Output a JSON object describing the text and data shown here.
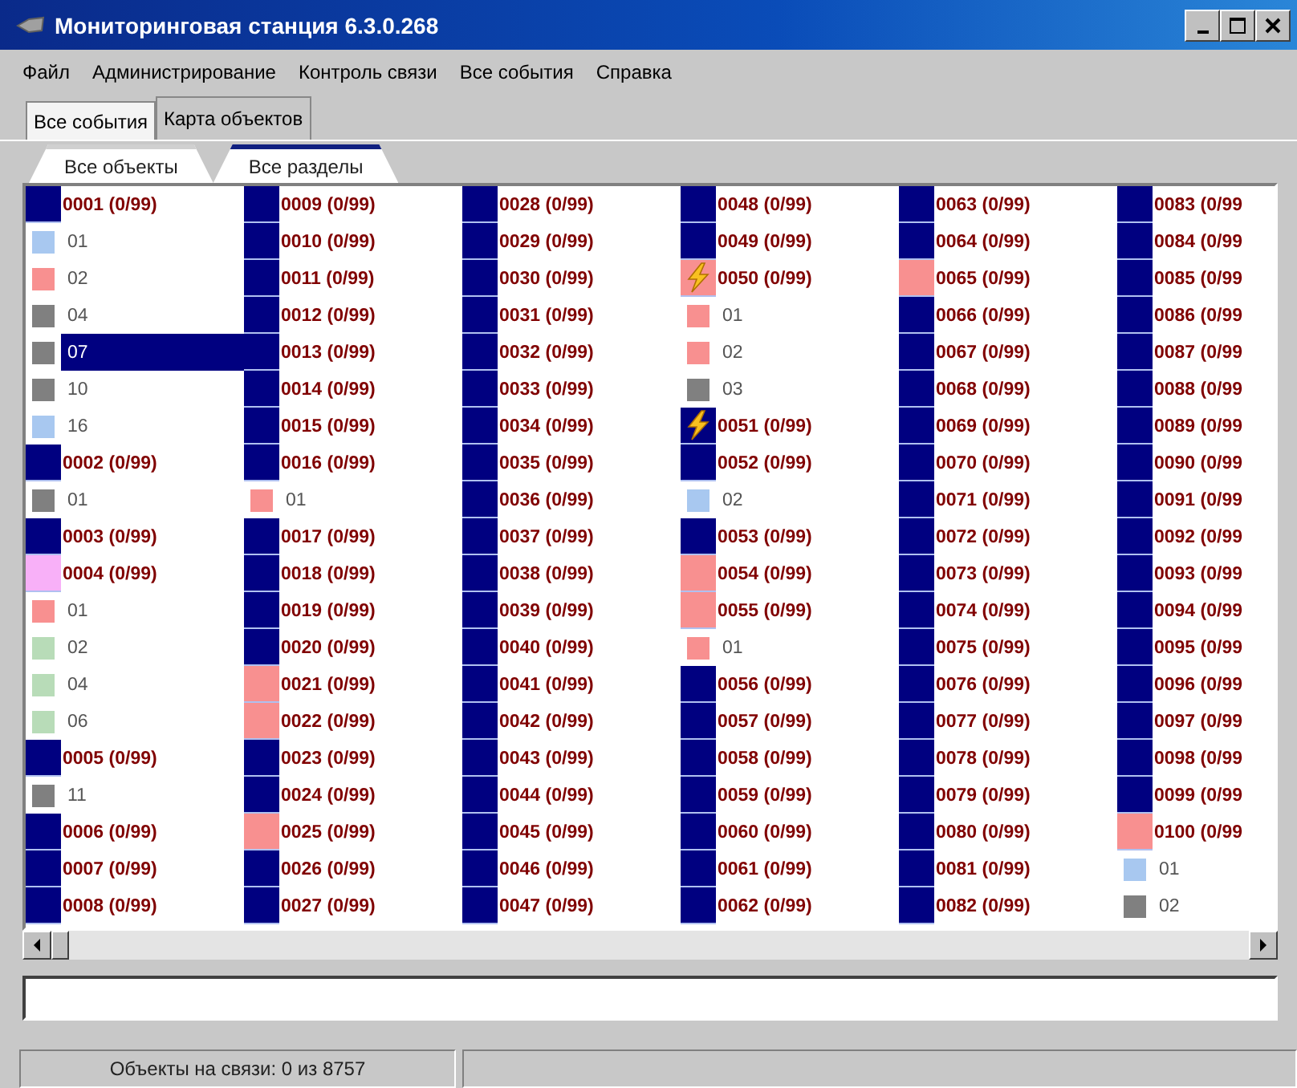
{
  "window": {
    "title": "Мониторинговая станция 6.3.0.268"
  },
  "menu": [
    "Файл",
    "Администрирование",
    "Контроль связи",
    "Все события",
    "Справка"
  ],
  "tabs": [
    {
      "label": "Все события",
      "selected": false
    },
    {
      "label": "Карта объектов",
      "selected": true
    }
  ],
  "subtabs": [
    {
      "label": "Все объекты",
      "selected": false
    },
    {
      "label": "Все разделы",
      "selected": true
    }
  ],
  "columns": [
    {
      "items": [
        {
          "kind": "object",
          "label": "0001 (0/99)",
          "color": "#000080",
          "selected": false
        },
        {
          "kind": "section",
          "label": "01",
          "color": "#a8c8f0",
          "selected": false
        },
        {
          "kind": "section",
          "label": "02",
          "color": "#f89090",
          "selected": false
        },
        {
          "kind": "section",
          "label": "04",
          "color": "#808080",
          "selected": false
        },
        {
          "kind": "section",
          "label": "07",
          "color": "#808080",
          "selected": true
        },
        {
          "kind": "section",
          "label": "10",
          "color": "#808080",
          "selected": false
        },
        {
          "kind": "section",
          "label": "16",
          "color": "#a8c8f0",
          "selected": false
        },
        {
          "kind": "object",
          "label": "0002 (0/99)",
          "color": "#000080",
          "selected": false
        },
        {
          "kind": "section",
          "label": "01",
          "color": "#808080",
          "selected": false
        },
        {
          "kind": "object",
          "label": "0003 (0/99)",
          "color": "#000080",
          "selected": false
        },
        {
          "kind": "object",
          "label": "0004 (0/99)",
          "color": "#f8b0f8",
          "selected": false
        },
        {
          "kind": "section",
          "label": "01",
          "color": "#f89090",
          "selected": false
        },
        {
          "kind": "section",
          "label": "02",
          "color": "#b8dcb8",
          "selected": false
        },
        {
          "kind": "section",
          "label": "04",
          "color": "#b8dcb8",
          "selected": false
        },
        {
          "kind": "section",
          "label": "06",
          "color": "#b8dcb8",
          "selected": false
        },
        {
          "kind": "object",
          "label": "0005 (0/99)",
          "color": "#000080",
          "selected": false
        },
        {
          "kind": "section",
          "label": "11",
          "color": "#808080",
          "selected": false
        },
        {
          "kind": "object",
          "label": "0006 (0/99)",
          "color": "#000080",
          "selected": false
        },
        {
          "kind": "object",
          "label": "0007 (0/99)",
          "color": "#000080",
          "selected": false
        },
        {
          "kind": "object",
          "label": "0008 (0/99)",
          "color": "#000080",
          "selected": false
        }
      ]
    },
    {
      "items": [
        {
          "kind": "object",
          "label": "0009 (0/99)",
          "color": "#000080",
          "selected": false
        },
        {
          "kind": "object",
          "label": "0010 (0/99)",
          "color": "#000080",
          "selected": false
        },
        {
          "kind": "object",
          "label": "0011 (0/99)",
          "color": "#000080",
          "selected": false
        },
        {
          "kind": "object",
          "label": "0012 (0/99)",
          "color": "#000080",
          "selected": false
        },
        {
          "kind": "object",
          "label": "0013 (0/99)",
          "color": "#000080",
          "selected": false
        },
        {
          "kind": "object",
          "label": "0014 (0/99)",
          "color": "#000080",
          "selected": false
        },
        {
          "kind": "object",
          "label": "0015 (0/99)",
          "color": "#000080",
          "selected": false
        },
        {
          "kind": "object",
          "label": "0016 (0/99)",
          "color": "#000080",
          "selected": false
        },
        {
          "kind": "section",
          "label": "01",
          "color": "#f89090",
          "selected": false
        },
        {
          "kind": "object",
          "label": "0017 (0/99)",
          "color": "#000080",
          "selected": false
        },
        {
          "kind": "object",
          "label": "0018 (0/99)",
          "color": "#000080",
          "selected": false
        },
        {
          "kind": "object",
          "label": "0019 (0/99)",
          "color": "#000080",
          "selected": false
        },
        {
          "kind": "object",
          "label": "0020 (0/99)",
          "color": "#000080",
          "selected": false
        },
        {
          "kind": "object",
          "label": "0021 (0/99)",
          "color": "#f89090",
          "selected": false
        },
        {
          "kind": "object",
          "label": "0022 (0/99)",
          "color": "#f89090",
          "selected": false
        },
        {
          "kind": "object",
          "label": "0023 (0/99)",
          "color": "#000080",
          "selected": false
        },
        {
          "kind": "object",
          "label": "0024 (0/99)",
          "color": "#000080",
          "selected": false
        },
        {
          "kind": "object",
          "label": "0025 (0/99)",
          "color": "#f89090",
          "selected": false
        },
        {
          "kind": "object",
          "label": "0026 (0/99)",
          "color": "#000080",
          "selected": false
        },
        {
          "kind": "object",
          "label": "0027 (0/99)",
          "color": "#000080",
          "selected": false
        }
      ]
    },
    {
      "items": [
        {
          "kind": "object",
          "label": "0028 (0/99)",
          "color": "#000080",
          "selected": false
        },
        {
          "kind": "object",
          "label": "0029 (0/99)",
          "color": "#000080",
          "selected": false
        },
        {
          "kind": "object",
          "label": "0030 (0/99)",
          "color": "#000080",
          "selected": false
        },
        {
          "kind": "object",
          "label": "0031 (0/99)",
          "color": "#000080",
          "selected": false
        },
        {
          "kind": "object",
          "label": "0032 (0/99)",
          "color": "#000080",
          "selected": false
        },
        {
          "kind": "object",
          "label": "0033 (0/99)",
          "color": "#000080",
          "selected": false
        },
        {
          "kind": "object",
          "label": "0034 (0/99)",
          "color": "#000080",
          "selected": false
        },
        {
          "kind": "object",
          "label": "0035 (0/99)",
          "color": "#000080",
          "selected": false
        },
        {
          "kind": "object",
          "label": "0036 (0/99)",
          "color": "#000080",
          "selected": false
        },
        {
          "kind": "object",
          "label": "0037 (0/99)",
          "color": "#000080",
          "selected": false
        },
        {
          "kind": "object",
          "label": "0038 (0/99)",
          "color": "#000080",
          "selected": false
        },
        {
          "kind": "object",
          "label": "0039 (0/99)",
          "color": "#000080",
          "selected": false
        },
        {
          "kind": "object",
          "label": "0040 (0/99)",
          "color": "#000080",
          "selected": false
        },
        {
          "kind": "object",
          "label": "0041 (0/99)",
          "color": "#000080",
          "selected": false
        },
        {
          "kind": "object",
          "label": "0042 (0/99)",
          "color": "#000080",
          "selected": false
        },
        {
          "kind": "object",
          "label": "0043 (0/99)",
          "color": "#000080",
          "selected": false
        },
        {
          "kind": "object",
          "label": "0044 (0/99)",
          "color": "#000080",
          "selected": false
        },
        {
          "kind": "object",
          "label": "0045 (0/99)",
          "color": "#000080",
          "selected": false
        },
        {
          "kind": "object",
          "label": "0046 (0/99)",
          "color": "#000080",
          "selected": false
        },
        {
          "kind": "object",
          "label": "0047 (0/99)",
          "color": "#000080",
          "selected": false
        }
      ]
    },
    {
      "items": [
        {
          "kind": "object",
          "label": "0048 (0/99)",
          "color": "#000080",
          "selected": false
        },
        {
          "kind": "object",
          "label": "0049 (0/99)",
          "color": "#000080",
          "selected": false
        },
        {
          "kind": "alarm_object",
          "label": "0050 (0/99)",
          "color": "#f89090",
          "selected": false
        },
        {
          "kind": "section",
          "label": "01",
          "color": "#f89090",
          "selected": false
        },
        {
          "kind": "section",
          "label": "02",
          "color": "#f89090",
          "selected": false
        },
        {
          "kind": "section",
          "label": "03",
          "color": "#808080",
          "selected": false
        },
        {
          "kind": "alarm_object",
          "label": "0051 (0/99)",
          "color": "#000080",
          "selected": false
        },
        {
          "kind": "object",
          "label": "0052 (0/99)",
          "color": "#000080",
          "selected": false
        },
        {
          "kind": "section",
          "label": "02",
          "color": "#a8c8f0",
          "selected": false
        },
        {
          "kind": "object",
          "label": "0053 (0/99)",
          "color": "#000080",
          "selected": false
        },
        {
          "kind": "object",
          "label": "0054 (0/99)",
          "color": "#f89090",
          "selected": false
        },
        {
          "kind": "object",
          "label": "0055 (0/99)",
          "color": "#f89090",
          "selected": false
        },
        {
          "kind": "section",
          "label": "01",
          "color": "#f89090",
          "selected": false
        },
        {
          "kind": "object",
          "label": "0056 (0/99)",
          "color": "#000080",
          "selected": false
        },
        {
          "kind": "object",
          "label": "0057 (0/99)",
          "color": "#000080",
          "selected": false
        },
        {
          "kind": "object",
          "label": "0058 (0/99)",
          "color": "#000080",
          "selected": false
        },
        {
          "kind": "object",
          "label": "0059 (0/99)",
          "color": "#000080",
          "selected": false
        },
        {
          "kind": "object",
          "label": "0060 (0/99)",
          "color": "#000080",
          "selected": false
        },
        {
          "kind": "object",
          "label": "0061 (0/99)",
          "color": "#000080",
          "selected": false
        },
        {
          "kind": "object",
          "label": "0062 (0/99)",
          "color": "#000080",
          "selected": false
        }
      ]
    },
    {
      "items": [
        {
          "kind": "object",
          "label": "0063 (0/99)",
          "color": "#000080",
          "selected": false
        },
        {
          "kind": "object",
          "label": "0064 (0/99)",
          "color": "#000080",
          "selected": false
        },
        {
          "kind": "object",
          "label": "0065 (0/99)",
          "color": "#f89090",
          "selected": false
        },
        {
          "kind": "object",
          "label": "0066 (0/99)",
          "color": "#000080",
          "selected": false
        },
        {
          "kind": "object",
          "label": "0067 (0/99)",
          "color": "#000080",
          "selected": false
        },
        {
          "kind": "object",
          "label": "0068 (0/99)",
          "color": "#000080",
          "selected": false
        },
        {
          "kind": "object",
          "label": "0069 (0/99)",
          "color": "#000080",
          "selected": false
        },
        {
          "kind": "object",
          "label": "0070 (0/99)",
          "color": "#000080",
          "selected": false
        },
        {
          "kind": "object",
          "label": "0071 (0/99)",
          "color": "#000080",
          "selected": false
        },
        {
          "kind": "object",
          "label": "0072 (0/99)",
          "color": "#000080",
          "selected": false
        },
        {
          "kind": "object",
          "label": "0073 (0/99)",
          "color": "#000080",
          "selected": false
        },
        {
          "kind": "object",
          "label": "0074 (0/99)",
          "color": "#000080",
          "selected": false
        },
        {
          "kind": "object",
          "label": "0075 (0/99)",
          "color": "#000080",
          "selected": false
        },
        {
          "kind": "object",
          "label": "0076 (0/99)",
          "color": "#000080",
          "selected": false
        },
        {
          "kind": "object",
          "label": "0077 (0/99)",
          "color": "#000080",
          "selected": false
        },
        {
          "kind": "object",
          "label": "0078 (0/99)",
          "color": "#000080",
          "selected": false
        },
        {
          "kind": "object",
          "label": "0079 (0/99)",
          "color": "#000080",
          "selected": false
        },
        {
          "kind": "object",
          "label": "0080 (0/99)",
          "color": "#000080",
          "selected": false
        },
        {
          "kind": "object",
          "label": "0081 (0/99)",
          "color": "#000080",
          "selected": false
        },
        {
          "kind": "object",
          "label": "0082 (0/99)",
          "color": "#000080",
          "selected": false
        }
      ]
    },
    {
      "items": [
        {
          "kind": "object",
          "label": "0083 (0/99",
          "color": "#000080",
          "selected": false
        },
        {
          "kind": "object",
          "label": "0084 (0/99",
          "color": "#000080",
          "selected": false
        },
        {
          "kind": "object",
          "label": "0085 (0/99",
          "color": "#000080",
          "selected": false
        },
        {
          "kind": "object",
          "label": "0086 (0/99",
          "color": "#000080",
          "selected": false
        },
        {
          "kind": "object",
          "label": "0087 (0/99",
          "color": "#000080",
          "selected": false
        },
        {
          "kind": "object",
          "label": "0088 (0/99",
          "color": "#000080",
          "selected": false
        },
        {
          "kind": "object",
          "label": "0089 (0/99",
          "color": "#000080",
          "selected": false
        },
        {
          "kind": "object",
          "label": "0090 (0/99",
          "color": "#000080",
          "selected": false
        },
        {
          "kind": "object",
          "label": "0091 (0/99",
          "color": "#000080",
          "selected": false
        },
        {
          "kind": "object",
          "label": "0092 (0/99",
          "color": "#000080",
          "selected": false
        },
        {
          "kind": "object",
          "label": "0093 (0/99",
          "color": "#000080",
          "selected": false
        },
        {
          "kind": "object",
          "label": "0094 (0/99",
          "color": "#000080",
          "selected": false
        },
        {
          "kind": "object",
          "label": "0095 (0/99",
          "color": "#000080",
          "selected": false
        },
        {
          "kind": "object",
          "label": "0096 (0/99",
          "color": "#000080",
          "selected": false
        },
        {
          "kind": "object",
          "label": "0097 (0/99",
          "color": "#000080",
          "selected": false
        },
        {
          "kind": "object",
          "label": "0098 (0/99",
          "color": "#000080",
          "selected": false
        },
        {
          "kind": "object",
          "label": "0099 (0/99",
          "color": "#000080",
          "selected": false
        },
        {
          "kind": "object",
          "label": "0100 (0/99",
          "color": "#f89090",
          "selected": false
        },
        {
          "kind": "section",
          "label": "01",
          "color": "#a8c8f0",
          "selected": false
        },
        {
          "kind": "section",
          "label": "02",
          "color": "#808080",
          "selected": false
        }
      ]
    }
  ],
  "status_bar": {
    "text": "Объекты на связи: 0 из 8757"
  }
}
